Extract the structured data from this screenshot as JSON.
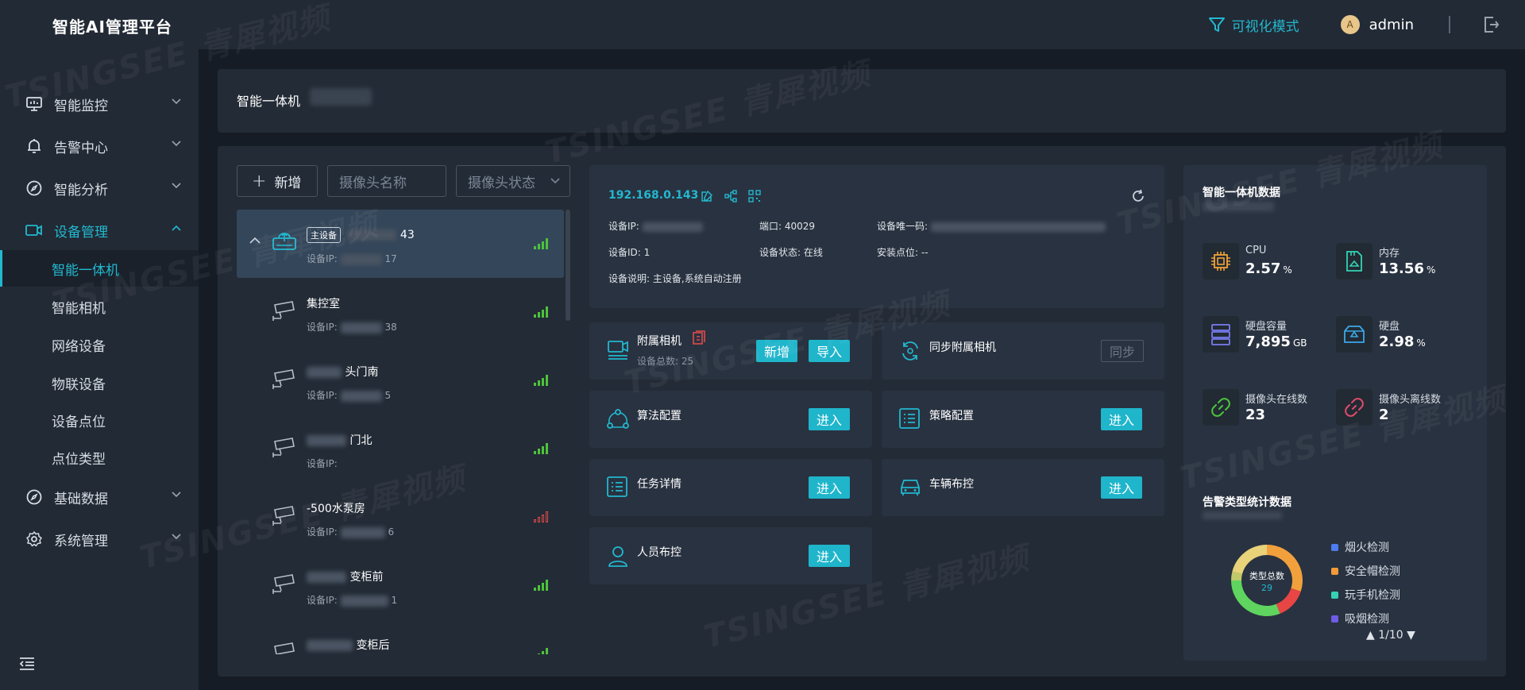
{
  "app": {
    "title": "智能AI管理平台",
    "visual_mode": "可视化模式",
    "user": "admin",
    "avatar_letter": "A"
  },
  "sidebar": {
    "menus": [
      {
        "label": "智能监控",
        "icon": "monitor-icon"
      },
      {
        "label": "告警中心",
        "icon": "bell-icon"
      },
      {
        "label": "智能分析",
        "icon": "compass-icon"
      },
      {
        "label": "设备管理",
        "icon": "camera-device-icon",
        "expanded": true
      },
      {
        "label": "基础数据",
        "icon": "compass-icon"
      },
      {
        "label": "系统管理",
        "icon": "gear-icon"
      }
    ],
    "sub_items": [
      {
        "label": "智能一体机",
        "active": true
      },
      {
        "label": "智能相机"
      },
      {
        "label": "网络设备"
      },
      {
        "label": "物联设备"
      },
      {
        "label": "设备点位"
      },
      {
        "label": "点位类型"
      }
    ]
  },
  "header": {
    "title": "智能一体机"
  },
  "toolbar": {
    "add_label": "新增",
    "name_placeholder": "摄像头名称",
    "status_placeholder": "摄像头状态"
  },
  "camera_list": [
    {
      "tag": "主设备",
      "name_suffix": "43",
      "ip_label": "设备IP:",
      "ip_suffix": "17",
      "signal": "good",
      "selected": true
    },
    {
      "name": "集控室",
      "ip_label": "设备IP:",
      "ip_suffix": "38",
      "signal": "good"
    },
    {
      "name_suffix": "头门南",
      "ip_label": "设备IP:",
      "ip_suffix": "5",
      "signal": "good"
    },
    {
      "name_suffix": "门北",
      "ip_label": "设备IP:",
      "ip_suffix": "",
      "signal": "good"
    },
    {
      "name": "-500水泵房",
      "ip_label": "设备IP:",
      "ip_suffix": "6",
      "signal": "bad"
    },
    {
      "name_suffix": "变柜前",
      "ip_label": "设备IP:",
      "ip_suffix": "1",
      "signal": "good"
    },
    {
      "name_suffix": "变柜后",
      "ip_label": "",
      "ip_suffix": "",
      "signal": "good"
    }
  ],
  "device": {
    "ip": "192.168.0.143",
    "ip_label": "设备IP:",
    "port_label": "端口:",
    "port": "40029",
    "uid_label": "设备唯一码:",
    "id_label": "设备ID:",
    "id": "1",
    "status_label": "设备状态:",
    "status": "在线",
    "location_label": "安装点位:",
    "location": "--",
    "desc_label": "设备说明:",
    "desc": "主设备,系统自动注册"
  },
  "functions": {
    "attached": {
      "title": "附属相机",
      "sub": "设备总数: 25",
      "btn_add": "新增",
      "btn_import": "导入"
    },
    "sync": {
      "title": "同步附属相机",
      "btn": "同步"
    },
    "algo": {
      "title": "算法配置",
      "btn": "进入"
    },
    "policy": {
      "title": "策略配置",
      "btn": "进入"
    },
    "task": {
      "title": "任务详情",
      "btn": "进入"
    },
    "vehicle": {
      "title": "车辆布控",
      "btn": "进入"
    },
    "person": {
      "title": "人员布控",
      "btn": "进入"
    }
  },
  "stats": {
    "title": "智能一体机数据",
    "cpu": {
      "label": "CPU",
      "value": "2.57",
      "unit": "%"
    },
    "mem": {
      "label": "内存",
      "value": "13.56",
      "unit": "%"
    },
    "disk_cap": {
      "label": "硬盘容量",
      "value": "7,895",
      "unit": "GB"
    },
    "disk": {
      "label": "硬盘",
      "value": "2.98",
      "unit": "%"
    },
    "cam_online": {
      "label": "摄像头在线数",
      "value": "23"
    },
    "cam_offline": {
      "label": "摄像头离线数",
      "value": "2"
    }
  },
  "alarm": {
    "title": "告警类型统计数据",
    "center_label": "类型总数",
    "center_value": "29",
    "legend": [
      {
        "name": "烟火检测",
        "color": "#4d7df0"
      },
      {
        "name": "安全帽检测",
        "color": "#f59a3a"
      },
      {
        "name": "玩手机检测",
        "color": "#35d3b4"
      },
      {
        "name": "吸烟检测",
        "color": "#6f5ce6"
      }
    ],
    "pager": "1/10",
    "slices": [
      {
        "fraction": 0.3,
        "color": "#f2a03c"
      },
      {
        "fraction": 0.14,
        "color": "#e84545"
      },
      {
        "fraction": 0.31,
        "color": "#5fd45f"
      },
      {
        "fraction": 0.04,
        "color": "#c0c96a"
      },
      {
        "fraction": 0.21,
        "color": "#e8d27a"
      }
    ]
  },
  "watermark": "TSINGSEE 青犀视频"
}
